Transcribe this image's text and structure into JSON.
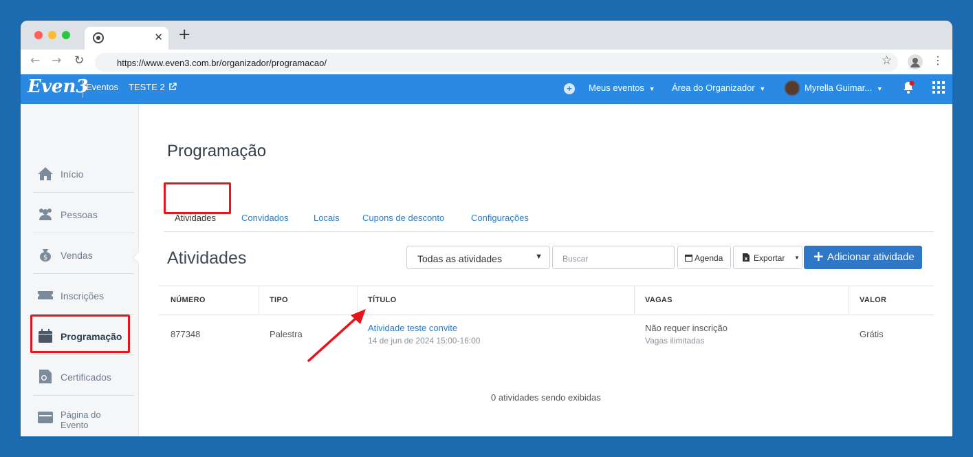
{
  "browser": {
    "tab_title": "",
    "url": "https://www.even3.com.br/organizador/programacao/"
  },
  "appbar": {
    "logo": "Even3",
    "eventos": "Eventos",
    "event_name": "TESTE 2",
    "meus_eventos": "Meus eventos",
    "area_organizador": "Área do Organizador",
    "user_name": "Myrella Guimar..."
  },
  "sidebar": {
    "items": [
      {
        "label": "Início",
        "icon": "home-icon"
      },
      {
        "label": "Pessoas",
        "icon": "people-icon"
      },
      {
        "label": "Vendas",
        "icon": "money-bag-icon"
      },
      {
        "label": "Inscrições",
        "icon": "ticket-icon"
      },
      {
        "label": "Programação",
        "icon": "calendar-icon"
      },
      {
        "label": "Certificados",
        "icon": "certificate-icon"
      },
      {
        "label": "Página do Evento",
        "icon": "browser-icon"
      }
    ],
    "active": "Programação"
  },
  "main": {
    "page_title": "Programação",
    "tabs": [
      {
        "label": "Atividades"
      },
      {
        "label": "Convidados"
      },
      {
        "label": "Locais"
      },
      {
        "label": "Cupons de desconto"
      },
      {
        "label": "Configurações"
      }
    ],
    "section_title": "Atividades",
    "filter_value": "Todas as atividades",
    "search_placeholder": "Buscar",
    "agenda_label": "Agenda",
    "export_label": "Exportar",
    "add_label": "Adicionar atividade",
    "table": {
      "headers": [
        "NÚMERO",
        "TIPO",
        "TÍTULO",
        "VAGAS",
        "VALOR"
      ],
      "rows": [
        {
          "numero": "877348",
          "tipo": "Palestra",
          "titulo": "Atividade teste convite",
          "data": "14 de jun de 2024 15:00-16:00",
          "vagas": "Não requer inscrição",
          "vagas_sub": "Vagas ilimitadas",
          "valor": "Grátis"
        }
      ]
    },
    "footer_count": "0 atividades sendo exibidas"
  },
  "colors": {
    "background": "#1c6bb0",
    "appbar": "#2a8ae3",
    "primary_button": "#2e78c7",
    "link": "#2a7bc4",
    "highlight": "#e8141b"
  }
}
